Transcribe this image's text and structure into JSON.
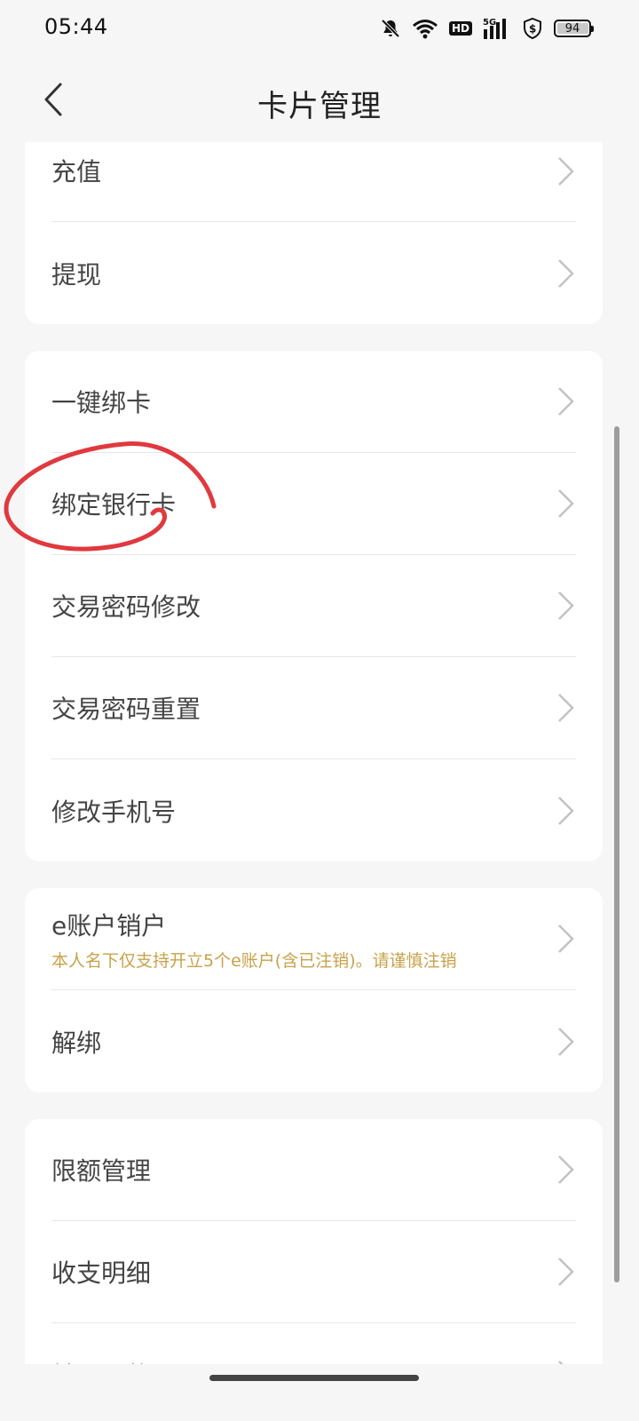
{
  "status_bar": {
    "time": "05:44",
    "signal": "5G",
    "hd": "HD",
    "battery": 94
  },
  "header": {
    "title": "卡片管理"
  },
  "cards": [
    {
      "rows": [
        {
          "label": "充值"
        },
        {
          "label": "提现"
        }
      ]
    },
    {
      "rows": [
        {
          "label": "一键绑卡"
        },
        {
          "label": "绑定银行卡"
        },
        {
          "label": "交易密码修改"
        },
        {
          "label": "交易密码重置"
        },
        {
          "label": "修改手机号"
        }
      ]
    },
    {
      "rows": [
        {
          "label": "e账户销户",
          "sub": "本人名下仅支持开立5个e账户(含已注销)。请谨慎注销"
        },
        {
          "label": "解绑"
        }
      ]
    },
    {
      "rows": [
        {
          "label": "限额管理"
        },
        {
          "label": "收支明细"
        },
        {
          "label": "转账汇款"
        }
      ]
    }
  ],
  "colors": {
    "background": "#f6f6f6",
    "card": "#ffffff",
    "warning_text": "#c9a24a",
    "annotation": "#e0393e"
  }
}
